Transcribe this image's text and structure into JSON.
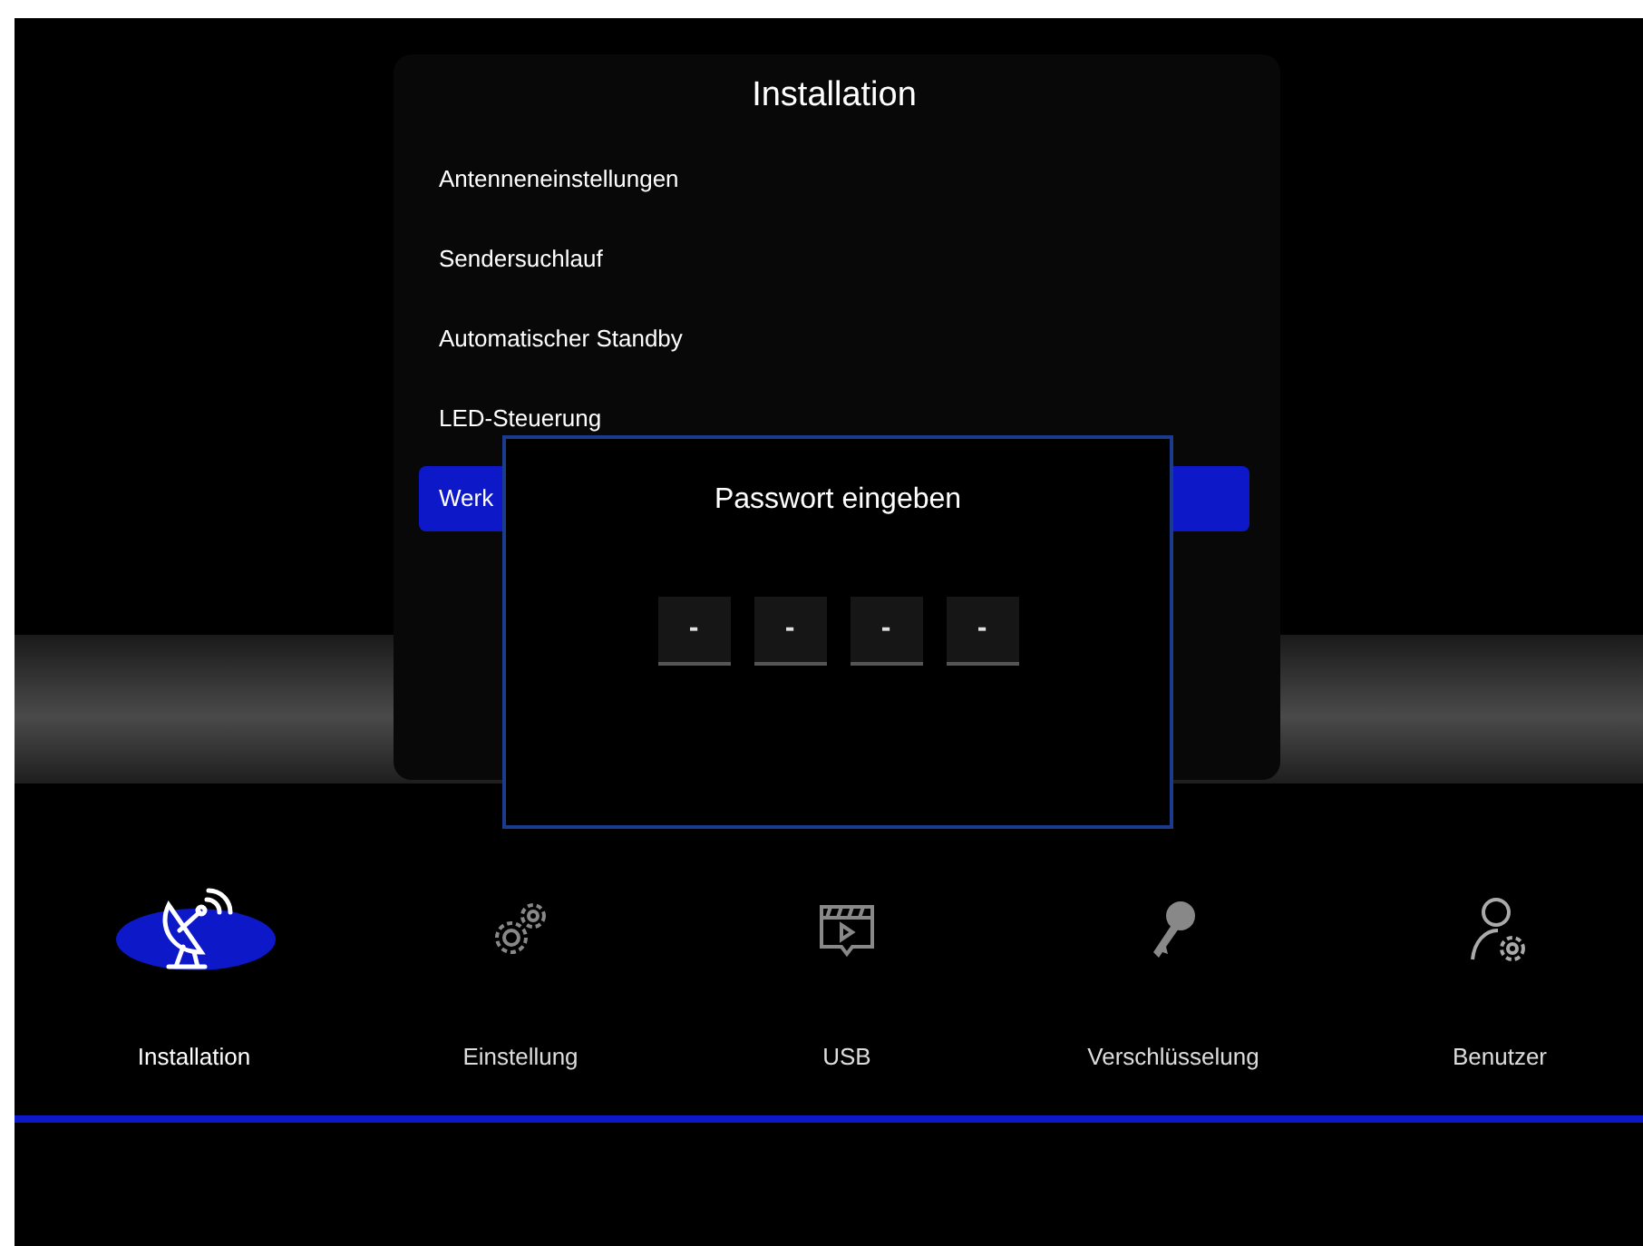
{
  "menu": {
    "title": "Installation",
    "items": [
      {
        "label": "Antenneneinstellungen",
        "selected": false
      },
      {
        "label": "Sendersuchlauf",
        "selected": false
      },
      {
        "label": "Automatischer Standby",
        "selected": false
      },
      {
        "label": "LED-Steuerung",
        "selected": false
      },
      {
        "label": "Werk",
        "selected": true
      }
    ]
  },
  "dialog": {
    "title": "Passwort eingeben",
    "digits": [
      "-",
      "-",
      "-",
      "-"
    ]
  },
  "nav": [
    {
      "label": "Installation",
      "kind": "satellite",
      "selected": true
    },
    {
      "label": "Einstellung",
      "kind": "gears",
      "selected": false
    },
    {
      "label": "USB",
      "kind": "video",
      "selected": false
    },
    {
      "label": "Verschlüsselung",
      "kind": "key",
      "selected": false
    },
    {
      "label": "Benutzer",
      "kind": "user-gear",
      "selected": false
    }
  ]
}
